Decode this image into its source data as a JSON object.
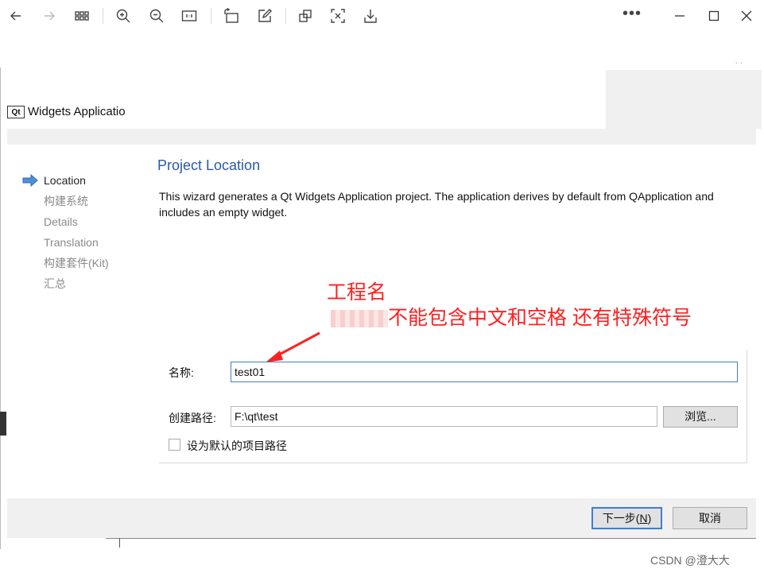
{
  "viewer_toolbar": {
    "buttons": [
      "back-icon",
      "forward-icon",
      "grid-view-icon",
      "zoom-in-icon",
      "zoom-out-icon",
      "actual-size-icon",
      "rotate-icon",
      "edit-icon",
      "crop-icon",
      "translate-icon",
      "save-icon"
    ],
    "more_label": "•••"
  },
  "window": {
    "title": "Widgets Applicatio",
    "icon_text": "Qt"
  },
  "steps": [
    {
      "label": "Location",
      "active": true
    },
    {
      "label": "构建系统",
      "active": false
    },
    {
      "label": "Details",
      "active": false
    },
    {
      "label": "Translation",
      "active": false
    },
    {
      "label": "构建套件(Kit)",
      "active": false
    },
    {
      "label": "汇总",
      "active": false
    }
  ],
  "page": {
    "title": "Project Location",
    "description": "This wizard generates a Qt Widgets Application project. The application derives by default from QApplication and includes an empty widget."
  },
  "annotation": {
    "line1": "工程名",
    "line2": "不能包含中文和空格  还有特殊符号",
    "color": "#ff2020"
  },
  "form": {
    "name_label": "名称:",
    "name_value": "test01",
    "path_label": "创建路径:",
    "path_value": "F:\\qt\\test",
    "browse_label": "浏览...",
    "default_path_label": "设为默认的项目路径"
  },
  "footer": {
    "next_label_prefix": "下一步(",
    "next_label_key": "N",
    "next_label_suffix": ")",
    "cancel_label": "取消"
  },
  "watermark": "CSDN @澄大大",
  "colors": {
    "accent": "#2a5aa8",
    "focus": "#3c7fd0",
    "annotation": "#ff2020"
  }
}
